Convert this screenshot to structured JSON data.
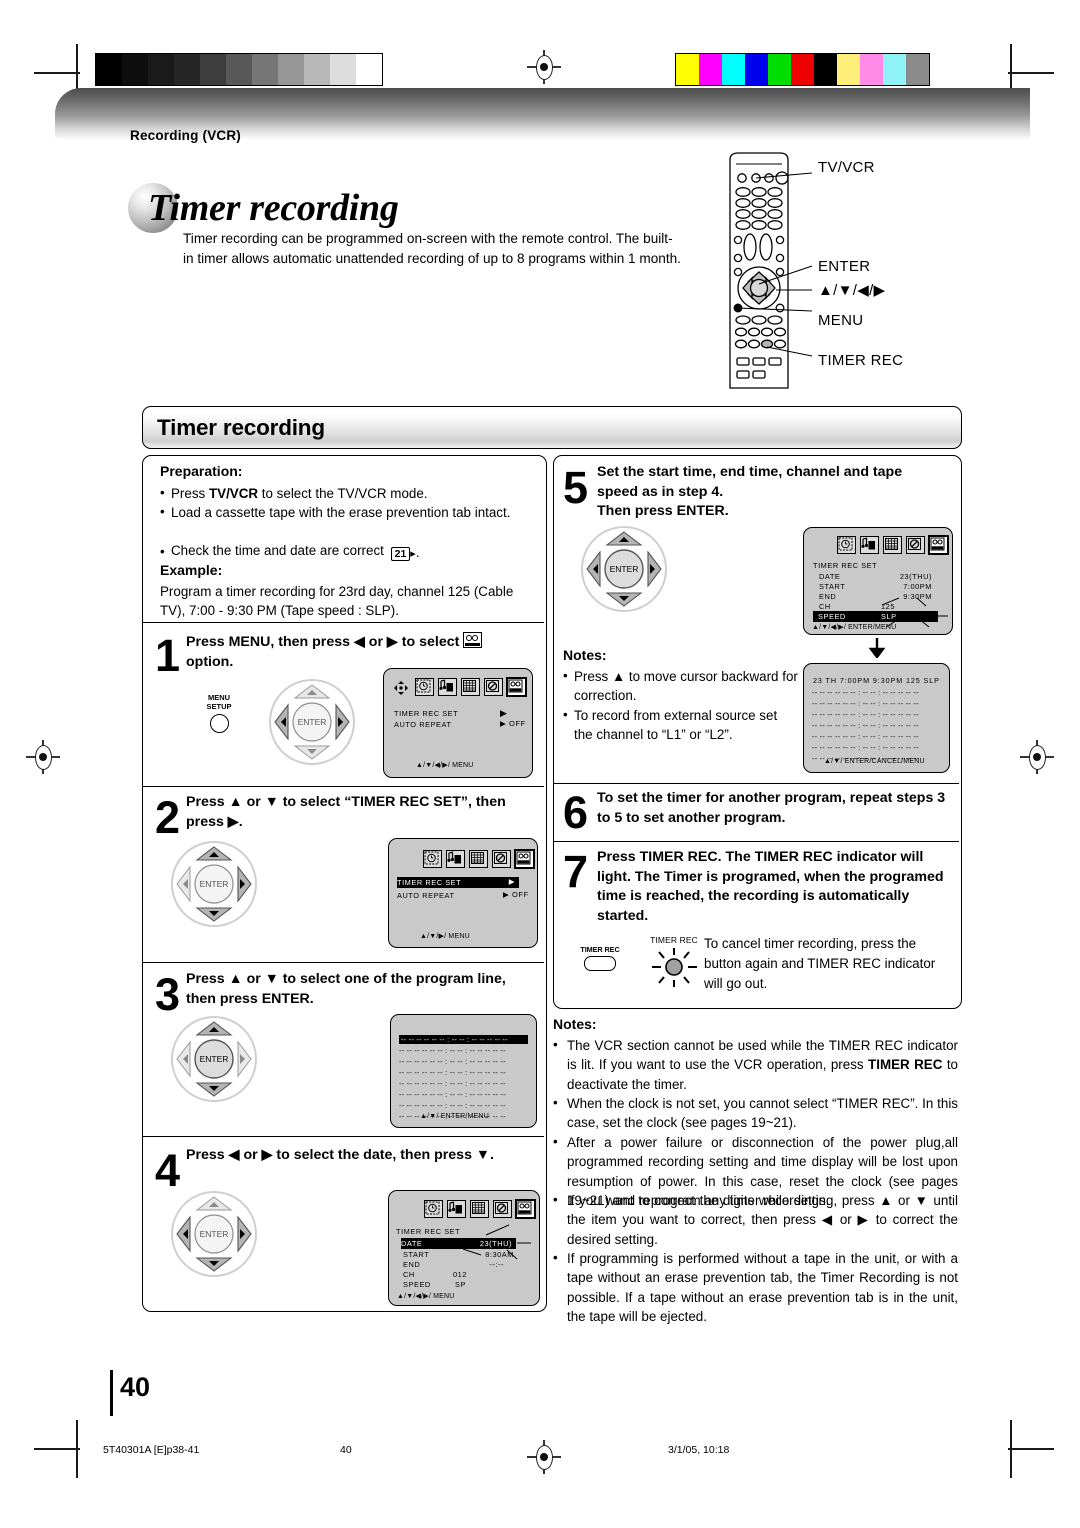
{
  "page": {
    "breadcrumb": "Recording (VCR)",
    "title": "Timer recording",
    "intro": "Timer recording can be programmed on-screen with the remote control. The built-in timer allows automatic unattended recording of up to 8 programs within 1 month.",
    "section_header": "Timer recording",
    "page_number": "40",
    "footer_left": "5T40301A [E]p38-41",
    "footer_center": "40",
    "footer_right": "3/1/05, 10:18"
  },
  "remote_callouts": [
    {
      "label": "TV/VCR"
    },
    {
      "label": "ENTER"
    },
    {
      "label": "▲/▼/◀/▶"
    },
    {
      "label": "MENU"
    },
    {
      "label": "TIMER REC"
    }
  ],
  "preparation": {
    "heading": "Preparation:",
    "items": [
      "Press TV/VCR to select the TV/VCR mode.",
      "Load a cassette tape with the erase prevention tab intact.",
      "Check the time and date are correct"
    ],
    "page_ref": "21",
    "example_heading": "Example:",
    "example_text": "Program a timer recording for 23rd day, channel 125 (Cable TV), 7:00 - 9:30 PM (Tape speed : SLP)."
  },
  "steps": [
    {
      "num": "1",
      "text": "Press MENU, then press ◀ or ▶ to select   option.",
      "button_label_line1": "MENU",
      "button_label_line2": "SETUP"
    },
    {
      "num": "2",
      "text": "Press ▲ or ▼ to select “TIMER REC SET”, then press ▶."
    },
    {
      "num": "3",
      "text": "Press ▲ or ▼ to select one of the program line, then press ENTER."
    },
    {
      "num": "4",
      "text": "Press ◀ or ▶ to select the date, then press ▼."
    },
    {
      "num": "5",
      "text": "Set the start time, end time, channel and tape speed as in step 4.",
      "text2": "Then press ENTER."
    },
    {
      "num": "6",
      "text": "To set the timer for another program, repeat steps 3 to 5 to set another program."
    },
    {
      "num": "7",
      "text": "Press TIMER REC. The TIMER REC indicator will light. The Timer is programed, when the programed time is reached, the recording is automatically started.",
      "indicator_label": "TIMER REC",
      "button_label": "TIMER REC",
      "cancel_text": "To cancel timer recording, press the button again and TIMER REC indicator will go out."
    }
  ],
  "osd": {
    "menu1": {
      "rows": [
        {
          "label": "TIMER REC SET",
          "value": "▶",
          "highlight": false
        },
        {
          "label": "AUTO REPEAT",
          "value": "▶ OFF",
          "highlight": false
        }
      ],
      "footer": "▲/▼/◀/▶/ MENU"
    },
    "menu2": {
      "rows": [
        {
          "label": "TIMER REC SET",
          "value": "▶",
          "highlight": true
        },
        {
          "label": "AUTO REPEAT",
          "value": "▶ OFF",
          "highlight": false
        }
      ],
      "footer": "▲/▼/▶/ MENU"
    },
    "proglist_empty": {
      "rows": [
        "-- -- -- -- --    -- : --      -- : --     -- -- --    --",
        "-- -- -- -- --    -- : --      -- : --     -- -- --    --",
        "-- -- -- -- --    -- : --      -- : --     -- -- --    --",
        "-- -- -- -- --    -- : --      -- : --     -- -- --    --",
        "-- -- -- -- --    -- : --      -- : --     -- -- --    --",
        "-- -- -- -- --    -- : --      -- : --     -- -- --    --",
        "-- -- -- -- --    -- : --      -- : --     -- -- --    --",
        "-- -- -- -- --    -- : --      -- : --     -- -- --    --"
      ],
      "footer": "▲/▼/ ENTER/MENU"
    },
    "timerset_step4": {
      "title": "TIMER REC SET",
      "rows": [
        {
          "label": "DATE",
          "value": "23(THU)",
          "highlight": true
        },
        {
          "label": "START",
          "value": "8:30AM",
          "highlight": false
        },
        {
          "label": "END",
          "value": "--:--",
          "highlight": false
        },
        {
          "label": "CH",
          "value": "012",
          "highlight": false
        },
        {
          "label": "SPEED",
          "value": "SP",
          "highlight": false
        }
      ],
      "footer": "▲/▼/◀/▶/ MENU"
    },
    "timerset_step5": {
      "title": "TIMER REC SET",
      "rows": [
        {
          "label": "DATE",
          "value": "23(THU)",
          "highlight": false
        },
        {
          "label": "START",
          "value": "7:00PM",
          "highlight": false
        },
        {
          "label": "END",
          "value": "9:30PM",
          "highlight": false
        },
        {
          "label": "CH",
          "value": "125",
          "highlight": false
        },
        {
          "label": "SPEED",
          "value": "SLP",
          "highlight": true
        }
      ],
      "footer": "▲/▼/◀/▶/ ENTER/MENU"
    },
    "proglist_filled": {
      "rows": [
        "23  TH  7:00PM  9:30PM  125  SLP",
        "-- -- -- -- --    -- : --      -- : --     -- -- --    --",
        "-- -- -- -- --    -- : --      -- : --     -- -- --    --",
        "-- -- -- -- --    -- : --      -- : --     -- -- --    --",
        "-- -- -- -- --    -- : --      -- : --     -- -- --    --",
        "-- -- -- -- --    -- : --      -- : --     -- -- --    --",
        "-- -- -- -- --    -- : --      -- : --     -- -- --    --",
        "-- -- -- -- --    -- : --      -- : --     -- -- --    --"
      ],
      "footer": "▲/▼/ ENTER/CANCEL/MENU"
    }
  },
  "notes_mid": {
    "heading": "Notes:",
    "items": [
      "Press ▲ to move cursor backward for correction.",
      "To record from external source set the channel to “L1” or “L2”."
    ]
  },
  "notes_bottom": {
    "heading": "Notes:",
    "items": [
      "The VCR section cannot be used while the TIMER REC indicator is lit. If you want to use the VCR operation, press TIMER REC to deactivate the timer.",
      "When the clock is not set, you cannot select “TIMER REC”. In this case, set the clock (see pages 19~21).",
      "After a power failure or disconnection of the power plug,all programmed recording setting and time display will be  lost upon resumption of power. In this case, reset the clock (see pages 19~21) and reprogram any timer recordings.",
      "If you want to correct the digits while setting, press ▲ or ▼ until the item you want to correct, then press ◀ or ▶ to correct the desired setting.",
      "If programming is performed without a tape in the unit, or with a tape without an erase prevention tab, the Timer Recording is not possible. If a tape without an erase prevention tab is in the unit, the tape will be ejected."
    ]
  },
  "colors": {
    "gray_ramp": [
      "#000000",
      "#0d0d0d",
      "#1a1a1a",
      "#262626",
      "#3d3d3d",
      "#585858",
      "#757575",
      "#969696",
      "#b8b8b8",
      "#dcdcdc",
      "#ffffff"
    ],
    "color_ramp": [
      "#ffff00",
      "#ff00ff",
      "#00ffff",
      "#0000ee",
      "#00dd00",
      "#ee0000",
      "#000000",
      "#ffef7a",
      "#ff8ae8",
      "#8ef2f7",
      "#8a8a8a"
    ]
  }
}
